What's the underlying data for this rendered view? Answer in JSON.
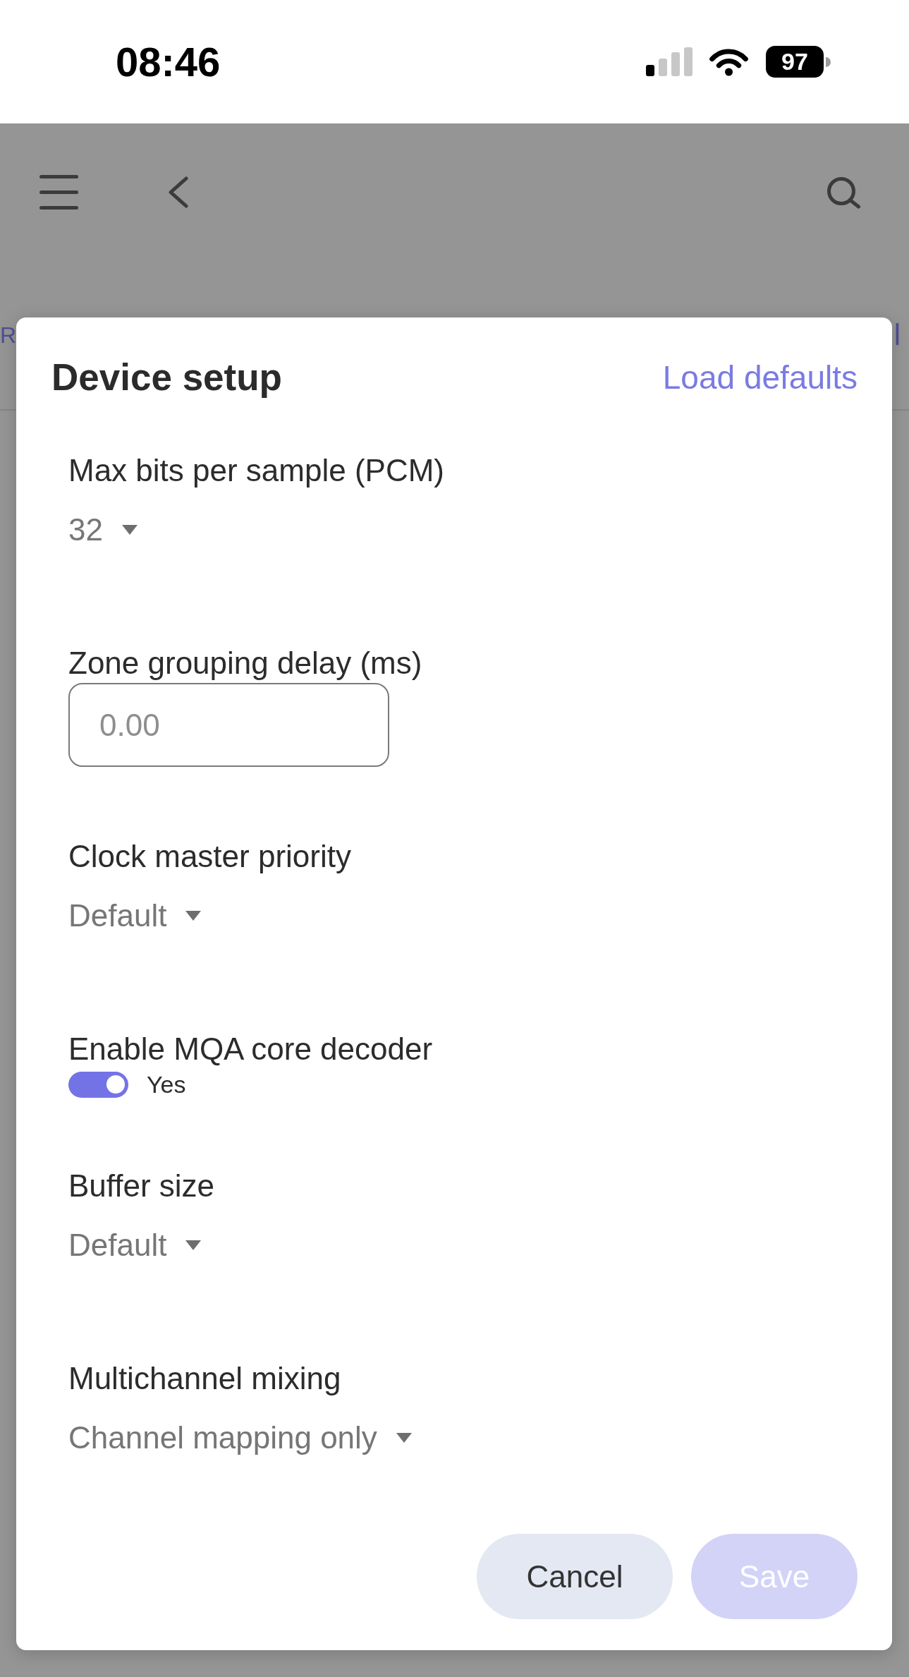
{
  "status_bar": {
    "time": "08:46",
    "battery": "97"
  },
  "background": {
    "tabs": [
      {
        "label": "R"
      },
      {
        "label": "l"
      }
    ]
  },
  "dialog": {
    "title": "Device setup",
    "action": "Load defaults",
    "fields": [
      {
        "kind": "dropdown",
        "label": "Max bits per sample (PCM)",
        "value": "32"
      },
      {
        "kind": "input",
        "label": "Zone grouping delay (ms)",
        "placeholder": "0.00"
      },
      {
        "kind": "dropdown",
        "label": "Clock master priority",
        "value": "Default"
      },
      {
        "kind": "toggle",
        "label": "Enable MQA core decoder",
        "on": true,
        "value": "Yes"
      },
      {
        "kind": "dropdown",
        "label": "Buffer size",
        "value": "Default"
      },
      {
        "kind": "dropdown",
        "label": "Multichannel mixing",
        "value": "Channel mapping only"
      }
    ],
    "buttons": [
      {
        "label": "Cancel",
        "kind": "secondary",
        "disabled": false
      },
      {
        "label": "Save",
        "kind": "primary",
        "disabled": true
      }
    ]
  }
}
